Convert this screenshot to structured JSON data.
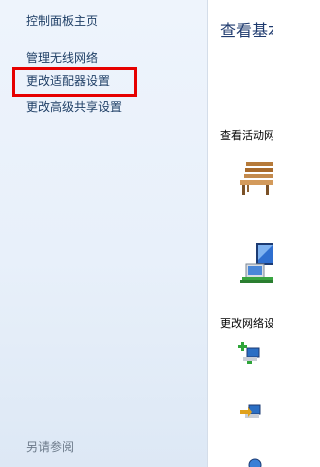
{
  "sidebar": {
    "home_link": "控制面板主页",
    "links": [
      "管理无线网络",
      "更改适配器设置",
      "更改高级共享设置"
    ],
    "see_also_label": "另请参阅"
  },
  "main": {
    "title": "查看基本",
    "active_networks_label": "查看活动网",
    "change_settings_label": "更改网络设"
  },
  "icons": {
    "bench": "park-bench-icon",
    "network": "computer-network-icon",
    "new_connection": "add-connection-icon",
    "connect_network": "connect-network-icon",
    "extra": "globe-icon"
  },
  "colors": {
    "highlight": "#e60000",
    "link": "#1f3f66",
    "title": "#1e3a6e"
  }
}
